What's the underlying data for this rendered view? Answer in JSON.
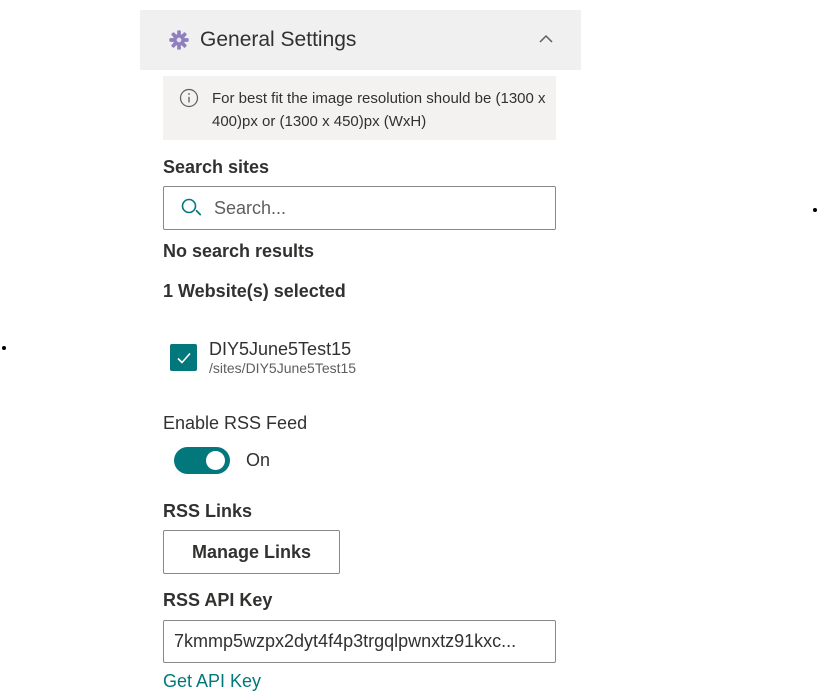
{
  "panel": {
    "title": "General Settings",
    "gear_icon": "gear-icon",
    "collapse_icon": "chevron-up-icon"
  },
  "info": {
    "icon": "info-icon",
    "text": "For best fit the image resolution should be (1300 x 400)px or (1300 x 450)px (WxH)"
  },
  "search": {
    "label": "Search sites",
    "placeholder": "Search...",
    "value": "",
    "icon": "search-icon",
    "no_results": "No search results"
  },
  "selection": {
    "summary": "1 Website(s) selected",
    "items": [
      {
        "name": "DIY5June5Test15",
        "path": "/sites/DIY5June5Test15",
        "checked": true
      }
    ]
  },
  "rss": {
    "enable_label": "Enable RSS Feed",
    "toggle_state": "On",
    "toggle_on": true,
    "links_label": "RSS Links",
    "manage_button": "Manage Links",
    "api_key_label": "RSS API Key",
    "api_key_value": "7kmmp5wzpx2dyt4f4p3trgqlpwnxtz91kxc...",
    "get_api_key_link": "Get API Key"
  },
  "colors": {
    "accent": "#03787c",
    "header_bg": "#f0f0f0",
    "info_bg": "#f3f2f1",
    "text": "#323130",
    "border": "#8a8886"
  }
}
